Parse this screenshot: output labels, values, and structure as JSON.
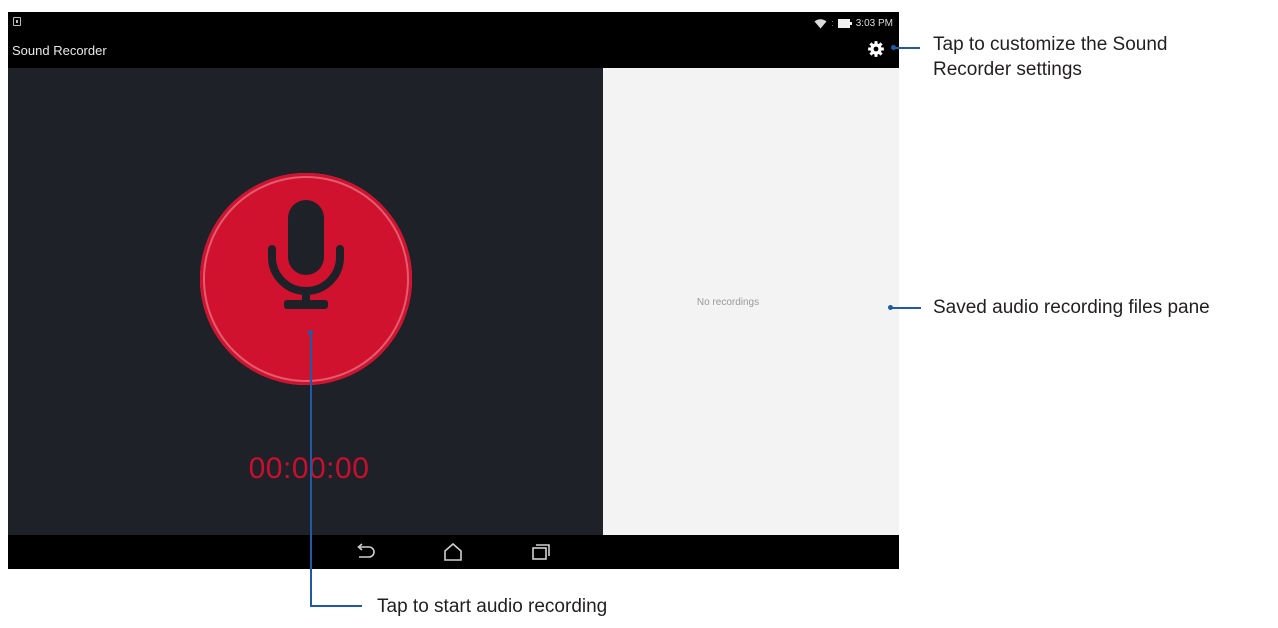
{
  "status_bar": {
    "time": "3:03 PM"
  },
  "app_bar": {
    "title": "Sound Recorder"
  },
  "recorder": {
    "timer": "00:00:00"
  },
  "files_pane": {
    "empty_text": "No recordings"
  },
  "callouts": {
    "settings_line1": "Tap to customize the Sound",
    "settings_line2": "Recorder settings",
    "files_pane": "Saved audio recording files pane",
    "record": "Tap to start audio recording"
  },
  "icons": {
    "settings": "gear-icon",
    "record": "microphone-icon",
    "back": "back-icon",
    "home": "home-icon",
    "recent": "recent-apps-icon",
    "wifi": "wifi-icon",
    "battery": "battery-icon"
  },
  "colors": {
    "record_red": "#d0122f",
    "callout_blue": "#1f5aa6",
    "app_background": "#1f2128",
    "files_pane_background": "#f3f3f3"
  }
}
